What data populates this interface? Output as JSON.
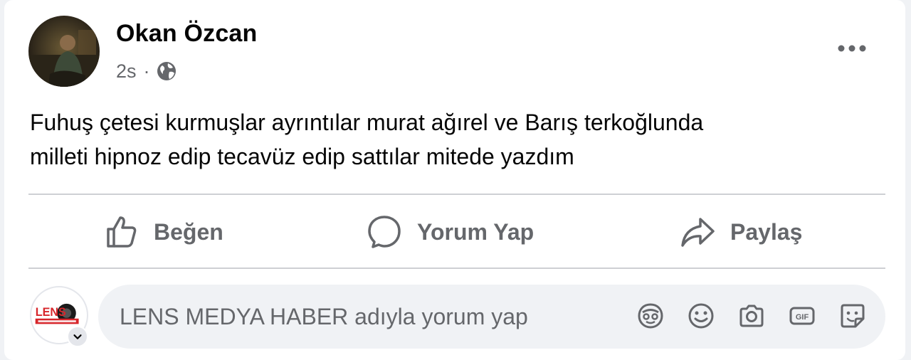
{
  "post": {
    "author": "Okan Özcan",
    "time": "2s",
    "separator": "·",
    "audience_icon": "globe-icon",
    "more_icon": "more-options-icon",
    "text_lines": [
      "Fuhuş çetesi kurmuşlar ayrıntılar murat ağırel ve Barış terkoğlunda",
      "milleti hipnoz edip tecavüz edip sattılar mitede yazdım"
    ]
  },
  "actions": {
    "like_label": "Beğen",
    "comment_label": "Yorum Yap",
    "share_label": "Paylaş"
  },
  "comment": {
    "placeholder": "LENS MEDYA HABER adıyla yorum yap",
    "value": "",
    "tools": [
      "avatar-sticker-icon",
      "emoji-icon",
      "camera-icon",
      "gif-icon",
      "sticker-icon"
    ]
  },
  "colors": {
    "text_primary": "#050505",
    "text_secondary": "#65676b",
    "divider": "#ced0d4",
    "input_bg": "#f0f2f5",
    "lens_red": "#d7262b"
  }
}
